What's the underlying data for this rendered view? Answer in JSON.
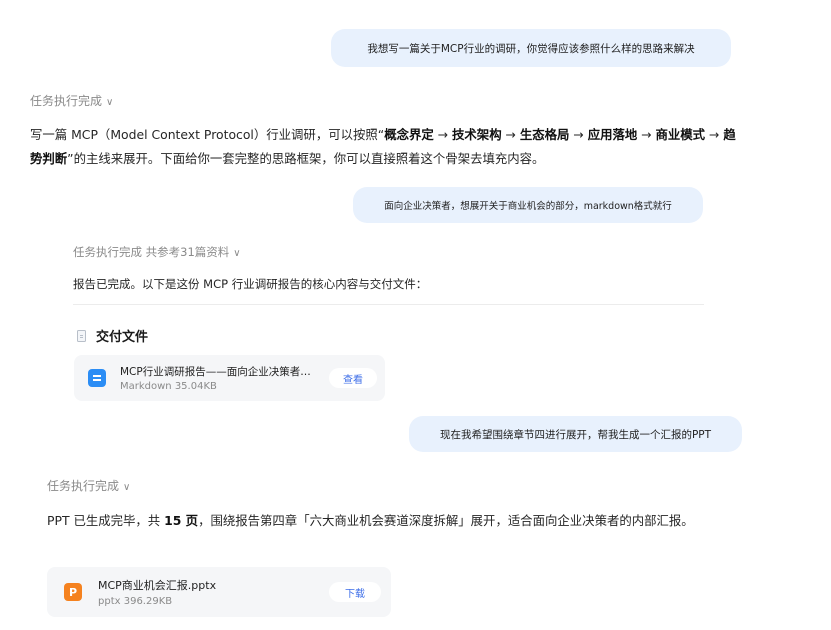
{
  "messages": {
    "user1": "我想写一篇关于MCP行业的调研，你觉得应该参照什么样的思路来解决",
    "status1": "任务执行完成",
    "reply1": {
      "pre": "写一篇 MCP（Model Context Protocol）行业调研，可以按照“",
      "b1": "概念界定",
      "arrow1": " → ",
      "b2": "技术架构",
      "arrow2": " → ",
      "b3": "生态格局",
      "arrow3": " → ",
      "b4": "应用落地",
      "arrow4": " → ",
      "b5": "商业模式",
      "arrow5": " → ",
      "b6": "趋势判断",
      "post": "”的主线来展开。下面给你一套完整的思路框架，你可以直接照着这个骨架去填充内容。"
    },
    "user2": "面向企业决策者，想展开关于商业机会的部分，markdown格式就行",
    "status2": "任务执行完成 共参考31篇资料",
    "reply2": "报告已完成。以下是这份 MCP 行业调研报告的核心内容与交付文件：",
    "deliver_title": "交付文件",
    "file1": {
      "name": "MCP行业调研报告——面向企业决策者…",
      "meta": "Markdown 35.04KB",
      "button": "查看"
    },
    "user3": "现在我希望围绕章节四进行展开，帮我生成一个汇报的PPT",
    "status3": "任务执行完成",
    "reply3": {
      "pre": "PPT 已生成完毕，共 ",
      "bold": "15 页",
      "post": "，围绕报告第四章「六大商业机会赛道深度拆解」展开，适合面向企业决策者的内部汇报。"
    },
    "file2": {
      "icon_letter": "P",
      "name": "MCP商业机会汇报.pptx",
      "meta": "pptx 396.29KB",
      "button": "下载"
    }
  },
  "icons": {
    "chevron": "chevron-down-icon",
    "doc": "document-icon",
    "markdown": "markdown-file-icon",
    "ppt": "pptx-file-icon"
  },
  "colors": {
    "user_bubble": "#e8f1fd",
    "link_blue": "#3d6ee8",
    "ppt_orange": "#f5821f",
    "md_blue": "#2b8df5"
  }
}
